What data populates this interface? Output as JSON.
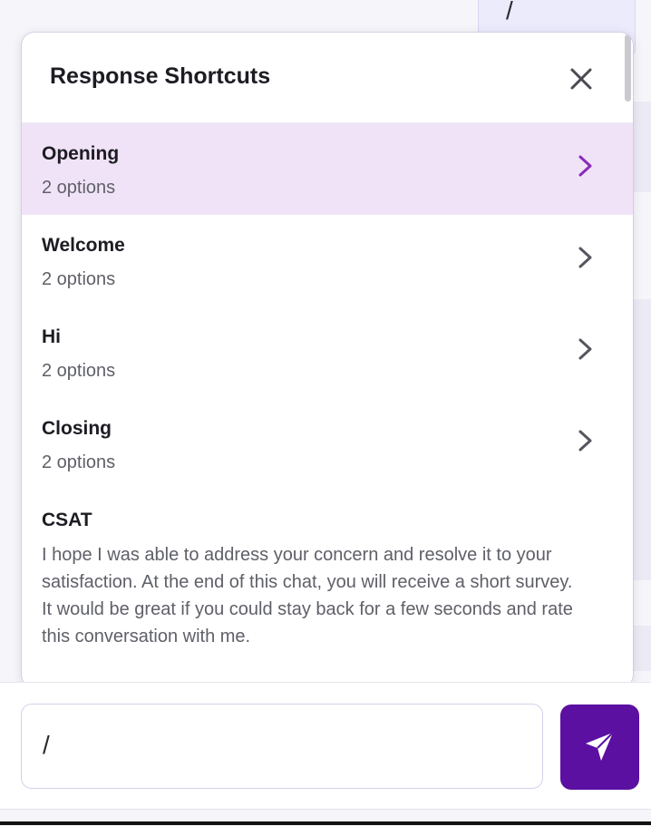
{
  "background": {
    "bubble_text": "/"
  },
  "popup": {
    "title": "Response Shortcuts",
    "close_icon": "close-icon",
    "items": [
      {
        "title": "Opening",
        "subtitle": "2 options",
        "active": true
      },
      {
        "title": "Welcome",
        "subtitle": "2 options",
        "active": false
      },
      {
        "title": "Hi",
        "subtitle": "2 options",
        "active": false
      },
      {
        "title": "Closing",
        "subtitle": "2 options",
        "active": false
      }
    ],
    "csat": {
      "title": "CSAT",
      "text": "I hope I was able to address your concern and resolve it to your satisfaction. At the end of this chat, you will receive a short survey. It would be great if you could stay back for a few seconds and rate this conversation with me."
    }
  },
  "composer": {
    "input_value": "/",
    "send_icon": "send-icon"
  },
  "colors": {
    "accent": "#5b10a1",
    "active_row": "#f1e3f7",
    "active_chevron": "#8a2bb8"
  }
}
